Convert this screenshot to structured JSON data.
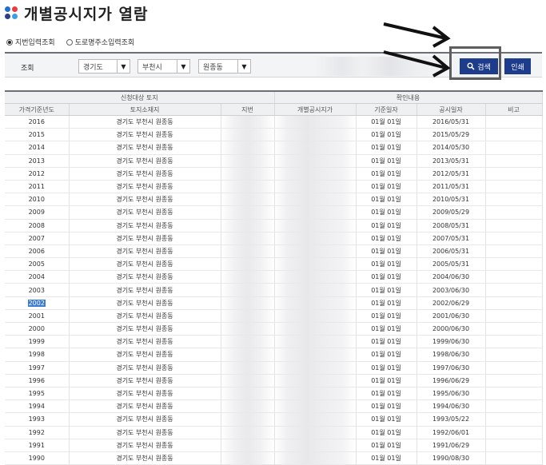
{
  "page": {
    "title": "개별공시지가 열람"
  },
  "search_mode": {
    "options": [
      "지번입력조회",
      "도로명주소입력조회"
    ],
    "selected": 0
  },
  "search": {
    "label": "조회",
    "province": "경기도",
    "city": "부천시",
    "district": "원종동",
    "search_button": "검색",
    "print_button": "인쇄"
  },
  "table": {
    "group_headers": [
      "신청대상 토지",
      "확인내용"
    ],
    "columns": [
      "가격기준년도",
      "토지소재지",
      "지번",
      "개별공시지가",
      "기준일자",
      "공시일자",
      "비고"
    ],
    "rows": [
      {
        "year": "2016",
        "location": "경기도 부천시 원종동",
        "base": "01월 01일",
        "pub": "2016/05/31"
      },
      {
        "year": "2015",
        "location": "경기도 부천시 원종동",
        "base": "01월 01일",
        "pub": "2015/05/29"
      },
      {
        "year": "2014",
        "location": "경기도 부천시 원종동",
        "base": "01월 01일",
        "pub": "2014/05/30"
      },
      {
        "year": "2013",
        "location": "경기도 부천시 원종동",
        "base": "01월 01일",
        "pub": "2013/05/31"
      },
      {
        "year": "2012",
        "location": "경기도 부천시 원종동",
        "base": "01월 01일",
        "pub": "2012/05/31"
      },
      {
        "year": "2011",
        "location": "경기도 부천시 원종동",
        "base": "01월 01일",
        "pub": "2011/05/31"
      },
      {
        "year": "2010",
        "location": "경기도 부천시 원종동",
        "base": "01월 01일",
        "pub": "2010/05/31"
      },
      {
        "year": "2009",
        "location": "경기도 부천시 원종동",
        "base": "01월 01일",
        "pub": "2009/05/29"
      },
      {
        "year": "2008",
        "location": "경기도 부천시 원종동",
        "base": "01월 01일",
        "pub": "2008/05/31"
      },
      {
        "year": "2007",
        "location": "경기도 부천시 원종동",
        "base": "01월 01일",
        "pub": "2007/05/31"
      },
      {
        "year": "2006",
        "location": "경기도 부천시 원종동",
        "base": "01월 01일",
        "pub": "2006/05/31"
      },
      {
        "year": "2005",
        "location": "경기도 부천시 원종동",
        "base": "01월 01일",
        "pub": "2005/05/31"
      },
      {
        "year": "2004",
        "location": "경기도 부천시 원종동",
        "base": "01월 01일",
        "pub": "2004/06/30"
      },
      {
        "year": "2003",
        "location": "경기도 부천시 원종동",
        "base": "01월 01일",
        "pub": "2003/06/30"
      },
      {
        "year": "2002",
        "location": "경기도 부천시 원종동",
        "base": "01월 01일",
        "pub": "2002/06/29"
      },
      {
        "year": "2001",
        "location": "경기도 부천시 원종동",
        "base": "01월 01일",
        "pub": "2001/06/30"
      },
      {
        "year": "2000",
        "location": "경기도 부천시 원종동",
        "base": "01월 01일",
        "pub": "2000/06/30"
      },
      {
        "year": "1999",
        "location": "경기도 부천시 원종동",
        "base": "01월 01일",
        "pub": "1999/06/30"
      },
      {
        "year": "1998",
        "location": "경기도 부천시 원종동",
        "base": "01월 01일",
        "pub": "1998/06/30"
      },
      {
        "year": "1997",
        "location": "경기도 부천시 원종동",
        "base": "01월 01일",
        "pub": "1997/06/30"
      },
      {
        "year": "1996",
        "location": "경기도 부천시 원종동",
        "base": "01월 01일",
        "pub": "1996/06/29"
      },
      {
        "year": "1995",
        "location": "경기도 부천시 원종동",
        "base": "01월 01일",
        "pub": "1995/06/30"
      },
      {
        "year": "1994",
        "location": "경기도 부천시 원종동",
        "base": "01월 01일",
        "pub": "1994/06/30"
      },
      {
        "year": "1993",
        "location": "경기도 부천시 원종동",
        "base": "01월 01일",
        "pub": "1993/05/22"
      },
      {
        "year": "1992",
        "location": "경기도 부천시 원종동",
        "base": "01월 01일",
        "pub": "1992/06/01"
      },
      {
        "year": "1991",
        "location": "경기도 부천시 원종동",
        "base": "01월 01일",
        "pub": "1991/06/29"
      },
      {
        "year": "1990",
        "location": "경기도 부천시 원종동",
        "base": "01월 01일",
        "pub": "1990/08/30"
      }
    ],
    "highlighted_year": "2002"
  },
  "icons": [
    "search-icon",
    "chevron-down-icon",
    "arrow-annotation"
  ],
  "colors": {
    "button": "#1e3c8c",
    "header_bg": "#eef0f2",
    "selection": "#3a7bd5",
    "annotation_box": "#5e5e5e"
  }
}
